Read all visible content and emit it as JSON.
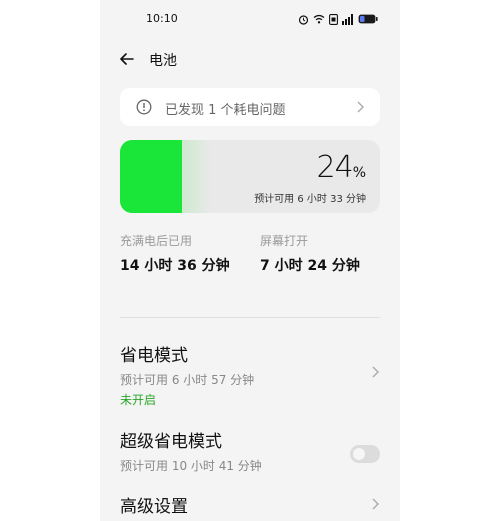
{
  "status_bar": {
    "time": "10:10"
  },
  "header": {
    "title": "电池"
  },
  "issue_banner": {
    "text": "已发现 1 个耗电问题"
  },
  "battery": {
    "percent": "24",
    "percent_sign": "%",
    "remaining_text": "预计可用 6 小时 33 分钟",
    "level_fraction": 0.24
  },
  "stats": [
    {
      "label": "充满电后已用",
      "value": "14 小时 36 分钟"
    },
    {
      "label": "屏幕打开",
      "value": "7 小时 24 分钟"
    }
  ],
  "settings": {
    "power_saving": {
      "title": "省电模式",
      "subtitle": "预计可用 6 小时 57 分钟",
      "status": "未开启"
    },
    "super_power_saving": {
      "title": "超级省电模式",
      "subtitle": "预计可用 10 小时 41 分钟",
      "enabled": false
    },
    "advanced": {
      "title": "高级设置"
    }
  },
  "colors": {
    "battery_fill": "#19e638",
    "status_off": "#2aa52a"
  },
  "icons": [
    "alarm-icon",
    "wifi-icon",
    "sim-icon",
    "signal-icon",
    "battery-icon",
    "back-arrow-icon",
    "info-circle-icon",
    "chevron-right-icon"
  ]
}
